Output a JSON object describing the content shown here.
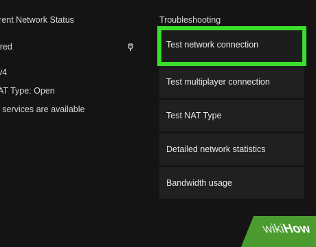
{
  "left_panel": {
    "title": "rrent Network Status",
    "rows": [
      "ired",
      "v4",
      "AT Type: Open",
      "l services are available"
    ]
  },
  "right_panel": {
    "title": "Troubleshooting",
    "items": [
      {
        "label": "Test network connection",
        "selected": true
      },
      {
        "label": "Test multiplayer connection",
        "selected": false
      },
      {
        "label": "Test NAT Type",
        "selected": false
      },
      {
        "label": "Detailed network statistics",
        "selected": false
      },
      {
        "label": "Bandwidth usage",
        "selected": false
      }
    ]
  },
  "watermark": {
    "wiki": "wiki",
    "how": "How"
  },
  "colors": {
    "background": "#141414",
    "highlight": "#3adf2b",
    "tile": "#202020",
    "watermark": "#4b9b2f"
  },
  "icons": {
    "plug": "wired-plug-icon"
  }
}
